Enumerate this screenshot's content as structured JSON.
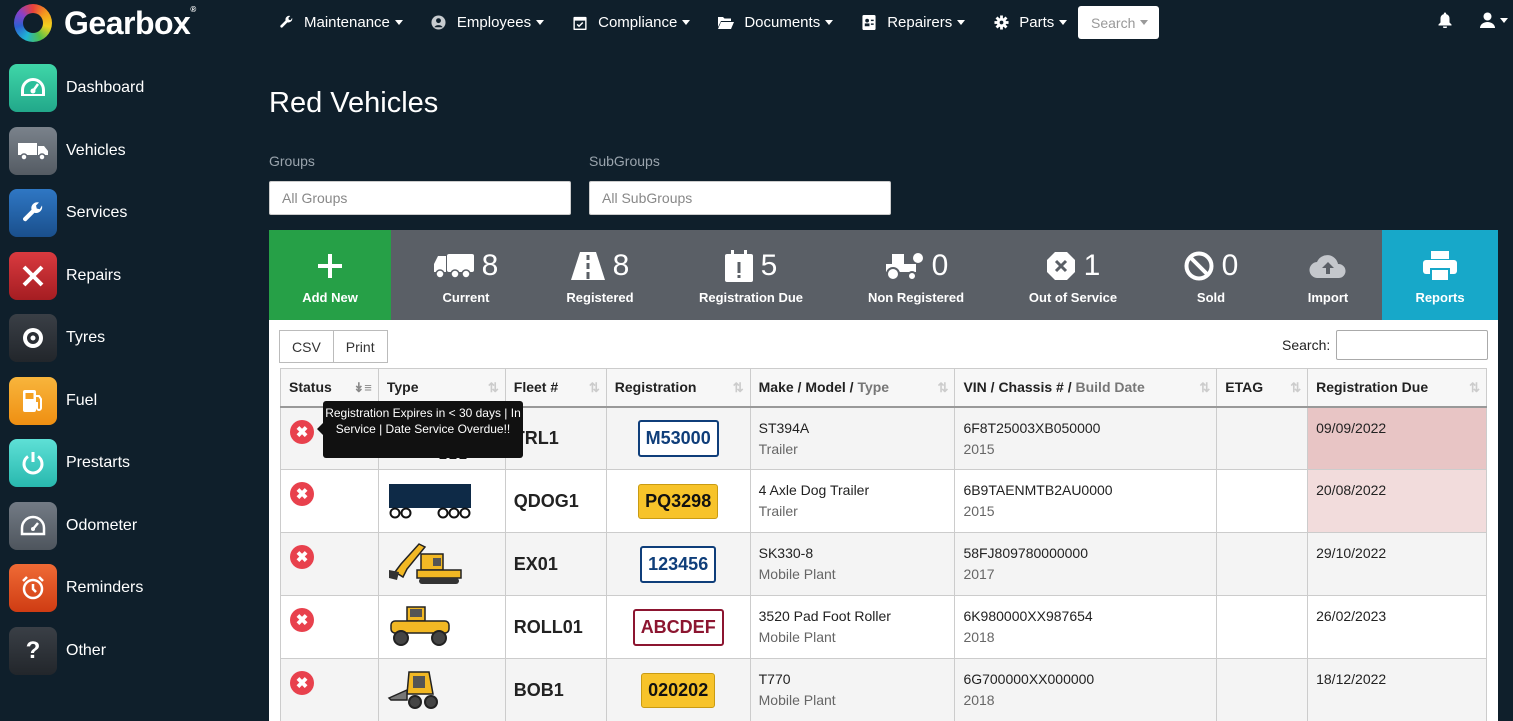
{
  "app": {
    "name": "Gearbox",
    "trademark": "®"
  },
  "nav": {
    "items": [
      {
        "label": "Maintenance",
        "icon": "wrench-icon"
      },
      {
        "label": "Employees",
        "icon": "user-circle-icon"
      },
      {
        "label": "Compliance",
        "icon": "calendar-check-icon"
      },
      {
        "label": "Documents",
        "icon": "folder-open-icon"
      },
      {
        "label": "Repairers",
        "icon": "address-card-icon"
      },
      {
        "label": "Parts",
        "icon": "gear-icon"
      }
    ],
    "search_label": "Search"
  },
  "sidebar": {
    "items": [
      {
        "label": "Dashboard",
        "icon": "dashboard-icon",
        "color": "#2bbf9a"
      },
      {
        "label": "Vehicles",
        "icon": "truck-icon",
        "color": "#6c757d"
      },
      {
        "label": "Services",
        "icon": "wrench-icon",
        "color": "#1f5fa6"
      },
      {
        "label": "Repairs",
        "icon": "tools-icon",
        "color": "#c0262b"
      },
      {
        "label": "Tyres",
        "icon": "tyre-icon",
        "color": "#2b2f35"
      },
      {
        "label": "Fuel",
        "icon": "fuel-pump-icon",
        "color": "#f5a020"
      },
      {
        "label": "Prestarts",
        "icon": "power-icon",
        "color": "#3dd1c7"
      },
      {
        "label": "Odometer",
        "icon": "odometer-icon",
        "color": "#5f6670"
      },
      {
        "label": "Reminders",
        "icon": "alarm-clock-icon",
        "color": "#e34d22"
      },
      {
        "label": "Other",
        "icon": "question-icon",
        "color": "#2b2f35"
      }
    ]
  },
  "page": {
    "title": "Red Vehicles"
  },
  "filters": {
    "groups_label": "Groups",
    "groups_value": "All Groups",
    "subgroups_label": "SubGroups",
    "subgroups_value": "All SubGroups"
  },
  "stats": {
    "add_label": "Add New",
    "current": {
      "count": "8",
      "label": "Current"
    },
    "registered": {
      "count": "8",
      "label": "Registered"
    },
    "registration_due": {
      "count": "5",
      "label": "Registration Due"
    },
    "non_registered": {
      "count": "0",
      "label": "Non Registered"
    },
    "out_of_service": {
      "count": "1",
      "label": "Out of Service"
    },
    "sold": {
      "count": "0",
      "label": "Sold"
    },
    "import_label": "Import",
    "reports_label": "Reports"
  },
  "table": {
    "csv_label": "CSV",
    "print_label": "Print",
    "search_label": "Search:",
    "headers": {
      "status": "Status",
      "type": "Type",
      "fleet": "Fleet #",
      "registration": "Registration",
      "make_model": "Make / Model",
      "type_sub": "Type",
      "vin": "VIN / Chassis #",
      "build_date": "Build Date",
      "etag": "ETAG",
      "reg_due": "Registration Due"
    },
    "rows": [
      {
        "fleet": "TRL1",
        "rego": "M53000",
        "plate_style": "blue",
        "model": "ST394A",
        "vtype": "Trailer",
        "vin": "6F8T25003XB050000",
        "year": "2015",
        "etag": "",
        "due": "09/09/2022",
        "due_style": "red",
        "icon": "trailer-icon"
      },
      {
        "fleet": "QDOG1",
        "rego": "PQ3298",
        "plate_style": "yellow",
        "model": "4 Axle Dog Trailer",
        "vtype": "Trailer",
        "vin": "6B9TAENMTB2AU0000",
        "year": "2015",
        "etag": "",
        "due": "20/08/2022",
        "due_style": "pink",
        "icon": "dog-trailer-icon"
      },
      {
        "fleet": "EX01",
        "rego": "123456",
        "plate_style": "blue",
        "model": "SK330-8",
        "vtype": "Mobile Plant",
        "vin": "58FJ809780000000",
        "year": "2017",
        "etag": "",
        "due": "29/10/2022",
        "due_style": "",
        "icon": "excavator-icon"
      },
      {
        "fleet": "ROLL01",
        "rego": "ABCDEF",
        "plate_style": "maroon",
        "model": "3520 Pad Foot Roller",
        "vtype": "Mobile Plant",
        "vin": "6K980000XX987654",
        "year": "2018",
        "etag": "",
        "due": "26/02/2023",
        "due_style": "",
        "icon": "roller-icon"
      },
      {
        "fleet": "BOB1",
        "rego": "020202",
        "plate_style": "yellow",
        "model": "T770",
        "vtype": "Mobile Plant",
        "vin": "6G700000XX000000",
        "year": "2018",
        "etag": "",
        "due": "18/12/2022",
        "due_style": "",
        "icon": "skid-steer-icon"
      }
    ],
    "status_icon": "x-circle-icon"
  },
  "tooltip": {
    "text": "Registration Expires in < 30 days | In Service | Date Service Overdue!!"
  }
}
